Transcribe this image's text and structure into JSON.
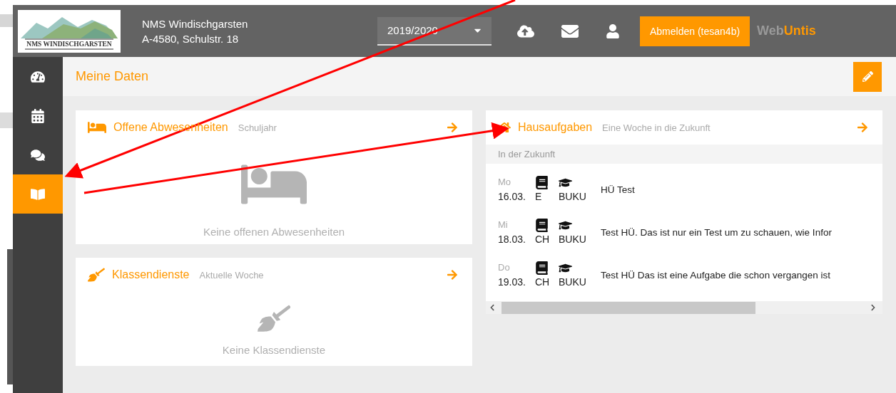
{
  "header": {
    "logo_text": "NMS WINDISCHGARSTEN",
    "school_name": "NMS Windischgarsten",
    "school_address": "A-4580, Schulstr. 18",
    "school_year": "2019/2020",
    "logout_button": "Abmelden (tesan4b)",
    "brand": {
      "part_1": "Web",
      "part_2": "Untis"
    }
  },
  "sidebar": {
    "items": [
      {
        "kind": "dashboard",
        "selected": false
      },
      {
        "kind": "calendar",
        "selected": false
      },
      {
        "kind": "messages",
        "selected": false
      },
      {
        "kind": "book",
        "selected": true
      }
    ]
  },
  "page": {
    "title": "Meine Daten"
  },
  "cards": [
    {
      "kind": "absences",
      "title": "Offene Abwesenheiten",
      "subtitle": "Schuljahr",
      "empty_text": "Keine offenen Abwesenheiten"
    },
    {
      "kind": "duties",
      "title": "Klassendienste",
      "subtitle": "Aktuelle Woche",
      "empty_text": "Keine Klassendienste"
    }
  ],
  "homework": {
    "title": "Hausaufgaben",
    "subtitle": "Eine Woche in die Zukunft",
    "section": "In der Zukunft",
    "rows": [
      {
        "day": "Mo",
        "date": "16.03.",
        "subject": "E",
        "teacher": "BUKU",
        "text": "HÜ Test"
      },
      {
        "day": "Mi",
        "date": "18.03.",
        "subject": "CH",
        "teacher": "BUKU",
        "text": "Test HÜ. Das ist nur ein Test um zu schauen, wie Infor"
      },
      {
        "day": "Do",
        "date": "19.03.",
        "subject": "CH",
        "teacher": "BUKU",
        "text": "Test HÜ Das ist eine Aufgabe die schon vergangen ist"
      }
    ]
  }
}
